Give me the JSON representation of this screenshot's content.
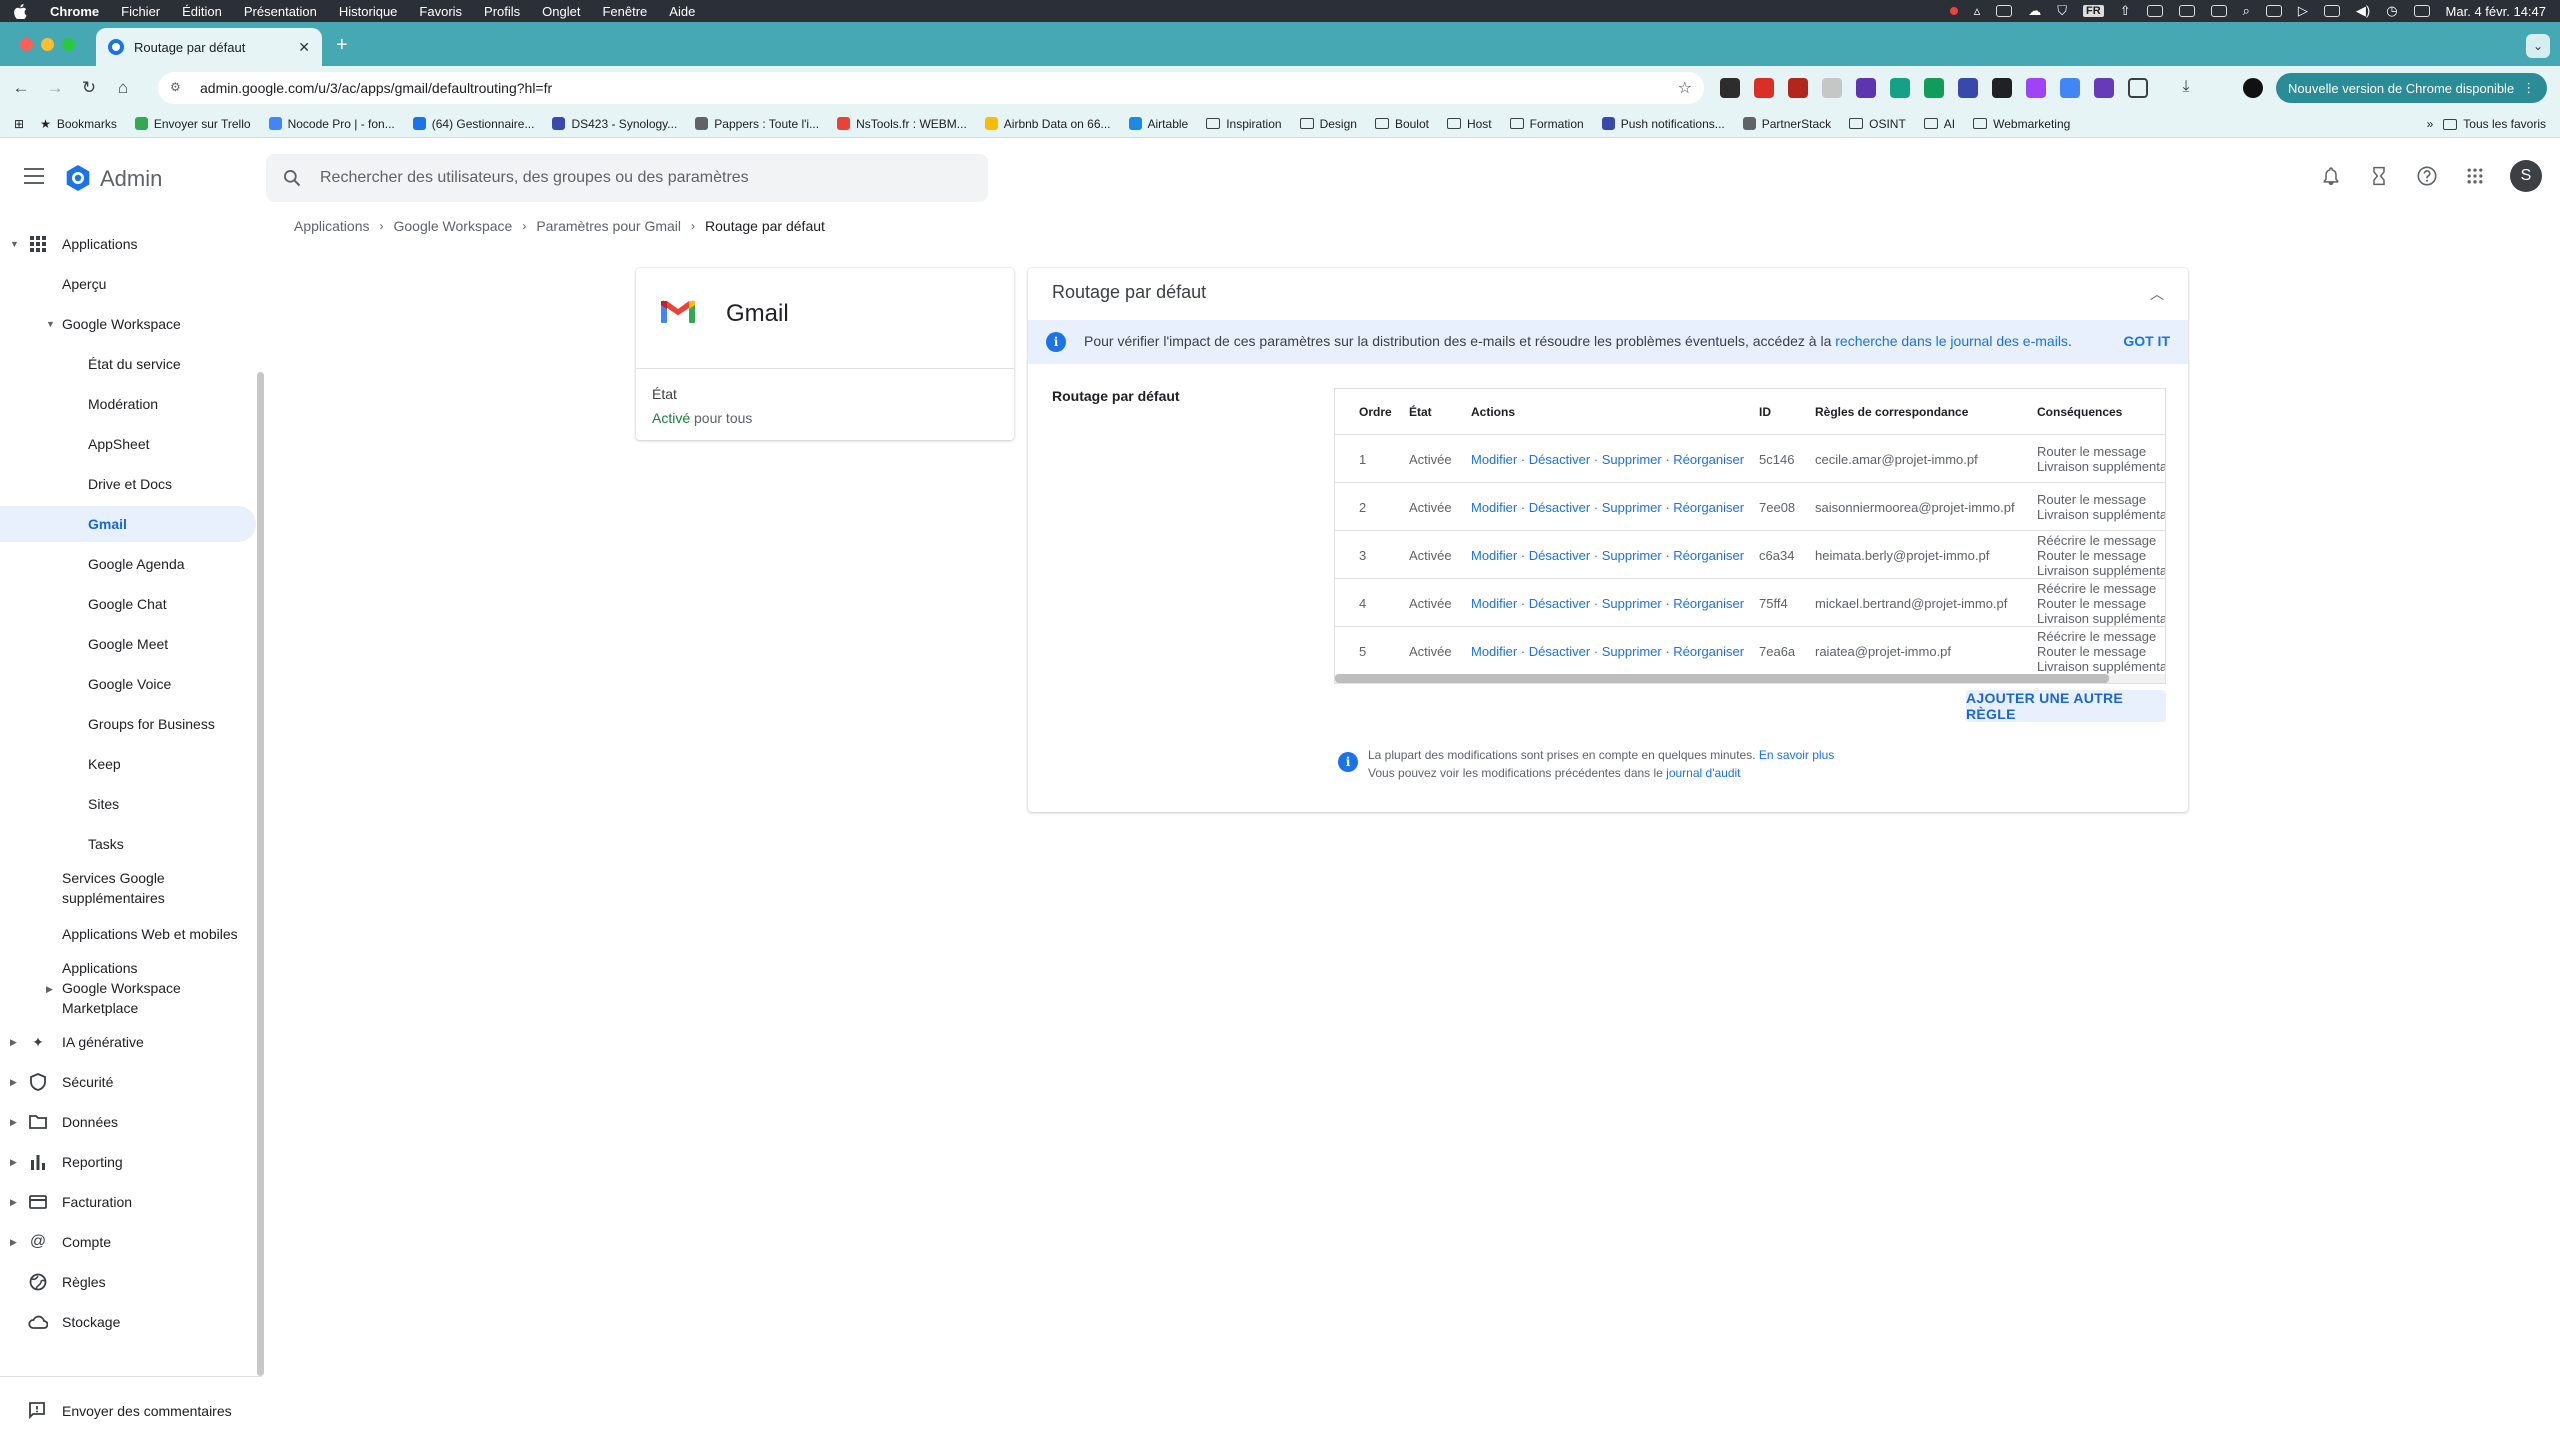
{
  "menubar": {
    "app": "Chrome",
    "items": [
      "Fichier",
      "Édition",
      "Présentation",
      "Historique",
      "Favoris",
      "Profils",
      "Onglet",
      "Fenêtre",
      "Aide"
    ],
    "input_lang": "FR",
    "datetime": "Mar. 4 févr. 14:47"
  },
  "browser": {
    "tab_title": "Routage par défaut",
    "url": "admin.google.com/u/3/ac/apps/gmail/defaultrouting?hl=fr",
    "update_label": "Nouvelle version de Chrome disponible",
    "bookmarks": [
      {
        "label": "Bookmarks",
        "kind": "star"
      },
      {
        "label": "Envoyer sur Trello",
        "kind": "icon"
      },
      {
        "label": "Nocode Pro | - fon...",
        "kind": "icon"
      },
      {
        "label": "(64) Gestionnaire...",
        "kind": "icon"
      },
      {
        "label": "DS423 - Synology...",
        "kind": "icon"
      },
      {
        "label": "Pappers : Toute l'i...",
        "kind": "icon"
      },
      {
        "label": "NsTools.fr : WEBM...",
        "kind": "icon"
      },
      {
        "label": "Airbnb Data on 66...",
        "kind": "icon"
      },
      {
        "label": "Airtable",
        "kind": "icon"
      },
      {
        "label": "Inspiration",
        "kind": "folder"
      },
      {
        "label": "Design",
        "kind": "folder"
      },
      {
        "label": "Boulot",
        "kind": "folder"
      },
      {
        "label": "Host",
        "kind": "folder"
      },
      {
        "label": "Formation",
        "kind": "folder"
      },
      {
        "label": "Push notifications...",
        "kind": "icon"
      },
      {
        "label": "PartnerStack",
        "kind": "icon"
      },
      {
        "label": "OSINT",
        "kind": "folder"
      },
      {
        "label": "AI",
        "kind": "folder"
      },
      {
        "label": "Webmarketing",
        "kind": "folder"
      }
    ],
    "all_bookmarks": "Tous les favoris",
    "more_bookmarks": "»"
  },
  "header": {
    "title": "Admin",
    "search_placeholder": "Rechercher des utilisateurs, des groupes ou des paramètres",
    "avatar_letter": "S"
  },
  "sidebar": {
    "applications": "Applications",
    "apercu": "Aperçu",
    "google_workspace": "Google Workspace",
    "workspace_children": [
      "État du service",
      "Modération",
      "AppSheet",
      "Drive et Docs",
      "Gmail",
      "Google Agenda",
      "Google Chat",
      "Google Meet",
      "Google Voice",
      "Groups for Business",
      "Keep",
      "Sites",
      "Tasks"
    ],
    "services_l1": "Services Google",
    "services_l2": "supplémentaires",
    "web_mobile": "Applications Web et mobiles",
    "marketplace_l1": "Applications",
    "marketplace_l2": "Google Workspace",
    "marketplace_l3": "Marketplace",
    "sections": [
      "IA générative",
      "Sécurité",
      "Données",
      "Reporting",
      "Facturation",
      "Compte",
      "Règles",
      "Stockage"
    ],
    "feedback": "Envoyer des commentaires"
  },
  "breadcrumb": [
    "Applications",
    "Google Workspace",
    "Paramètres pour Gmail",
    "Routage par défaut"
  ],
  "app_card": {
    "name": "Gmail",
    "state_label": "État",
    "state_value": "Activé",
    "state_suffix": " pour tous"
  },
  "panel": {
    "title": "Routage par défaut",
    "banner_text": "Pour vérifier l'impact de ces paramètres sur la distribution des e-mails et résoudre les problèmes éventuels, accédez à la ",
    "banner_link": "recherche dans le journal des e-mails",
    "banner_end": ".",
    "got_it": "GOT IT",
    "section_label": "Routage par défaut",
    "columns": [
      "Ordre",
      "État",
      "Actions",
      "ID",
      "Règles de correspondance",
      "Conséquences"
    ],
    "rows": [
      {
        "order": "1",
        "state": "Activée",
        "actions": "Modifier · Désactiver · Supprimer · Réorganiser",
        "id": "5c146",
        "match": "cecile.amar@projet-immo.pf",
        "consequences": [
          "Router le message",
          "Livraison supplémenta"
        ]
      },
      {
        "order": "2",
        "state": "Activée",
        "actions": "Modifier · Désactiver · Supprimer · Réorganiser",
        "id": "7ee08",
        "match": "saisonniermoorea@projet-immo.pf",
        "consequences": [
          "Router le message",
          "Livraison supplémenta"
        ]
      },
      {
        "order": "3",
        "state": "Activée",
        "actions": "Modifier · Désactiver · Supprimer · Réorganiser",
        "id": "c6a34",
        "match": "heimata.berly@projet-immo.pf",
        "consequences": [
          "Réécrire le message",
          "Router le message",
          "Livraison supplémenta"
        ]
      },
      {
        "order": "4",
        "state": "Activée",
        "actions": "Modifier · Désactiver · Supprimer · Réorganiser",
        "id": "75ff4",
        "match": "mickael.bertrand@projet-immo.pf",
        "consequences": [
          "Réécrire le message",
          "Router le message",
          "Livraison supplémenta"
        ]
      },
      {
        "order": "5",
        "state": "Activée",
        "actions": "Modifier · Désactiver · Supprimer · Réorganiser",
        "id": "7ea6a",
        "match": "raiatea@projet-immo.pf",
        "consequences": [
          "Réécrire le message",
          "Router le message",
          "Livraison supplémenta"
        ]
      }
    ],
    "add_rule": "AJOUTER UNE AUTRE RÈGLE",
    "footer_l1": "La plupart des modifications sont prises en compte en quelques minutes. ",
    "footer_l1_link": "En savoir plus",
    "footer_l2": "Vous pouvez voir les modifications précédentes dans le ",
    "footer_l2_link": "journal d'audit"
  },
  "colors": {
    "accent": "#1a73e8",
    "tab_strip": "#45a8b2",
    "active_green": "#188038"
  }
}
